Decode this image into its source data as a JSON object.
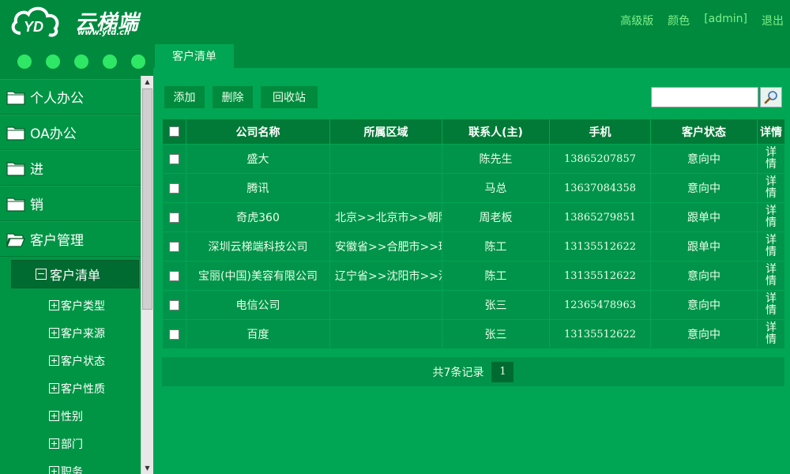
{
  "header": {
    "logo_text": "云梯端",
    "logo_url": "www.ytd.cn",
    "links": [
      "高级版",
      "颜色",
      "[admin]",
      "退出"
    ]
  },
  "tabs": [
    {
      "label": "客户清单"
    }
  ],
  "sidebar": {
    "menus": [
      {
        "label": "个人办公",
        "icon": "folder-icon"
      },
      {
        "label": "OA办公",
        "icon": "folder-icon"
      },
      {
        "label": "进",
        "icon": "folder-icon"
      },
      {
        "label": "销",
        "icon": "folder-icon"
      },
      {
        "label": "客户管理",
        "icon": "folder-open-icon"
      }
    ],
    "active_sub": "客户清单",
    "leaves": [
      "客户类型",
      "客户来源",
      "客户状态",
      "客户性质",
      "性别",
      "部门",
      "职务"
    ]
  },
  "toolbar": {
    "add_label": "添加",
    "delete_label": "删除",
    "recycle_label": "回收站",
    "search_value": ""
  },
  "table": {
    "columns": [
      "公司名称",
      "所属区域",
      "联系人(主)",
      "手机",
      "客户状态",
      "详情"
    ],
    "rows": [
      {
        "company": "盛大",
        "region": "",
        "contact": "陈先生",
        "phone": "13865207857",
        "status": "意向中",
        "detail": "详情"
      },
      {
        "company": "腾讯",
        "region": "",
        "contact": "马总",
        "phone": "13637084358",
        "status": "意向中",
        "detail": "详情"
      },
      {
        "company": "奇虎360",
        "region": "北京>>北京市>>朝阳",
        "contact": "周老板",
        "phone": "13865279851",
        "status": "跟单中",
        "detail": "详情"
      },
      {
        "company": "深圳云梯端科技公司",
        "region": "安徽省>>合肥市>>瑶",
        "contact": "陈工",
        "phone": "13135512622",
        "status": "跟单中",
        "detail": "详情"
      },
      {
        "company": "宝丽(中国)美容有限公司",
        "region": "辽宁省>>沈阳市>>沈",
        "contact": "陈工",
        "phone": "13135512622",
        "status": "意向中",
        "detail": "详情"
      },
      {
        "company": "电信公司",
        "region": "",
        "contact": "张三",
        "phone": "12365478963",
        "status": "意向中",
        "detail": "详情"
      },
      {
        "company": "百度",
        "region": "",
        "contact": "张三",
        "phone": "13135512622",
        "status": "意向中",
        "detail": "详情"
      }
    ]
  },
  "pager": {
    "summary": "共7条记录",
    "current_page": "1"
  },
  "colors": {
    "header_bg": "#008a3e",
    "content_bg": "#00a653",
    "cell_bg": "#00944a",
    "accent_dot": "#2ee865"
  }
}
